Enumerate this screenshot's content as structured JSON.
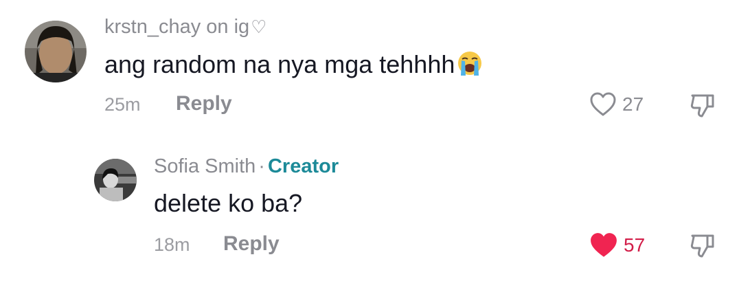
{
  "comments": [
    {
      "username": "krstn_chay on ig",
      "username_heart": "♡",
      "text": "ang random na nya mga tehhhh",
      "emoji": "loudly-crying-face",
      "time": "25m",
      "reply_label": "Reply",
      "likes": "27",
      "liked": false
    },
    {
      "username": "Sofia Smith",
      "separator": "·",
      "badge": "Creator",
      "text": "delete ko ba?",
      "time": "18m",
      "reply_label": "Reply",
      "likes": "57",
      "liked": true
    }
  ],
  "colors": {
    "creator_badge": "#1c8a98",
    "liked_heart": "#f02451",
    "text_primary": "#161823",
    "text_secondary": "#8a8b91"
  },
  "icons": [
    "heart-outline-icon",
    "heart-filled-icon",
    "dislike-icon",
    "loudly-crying-face-emoji"
  ]
}
